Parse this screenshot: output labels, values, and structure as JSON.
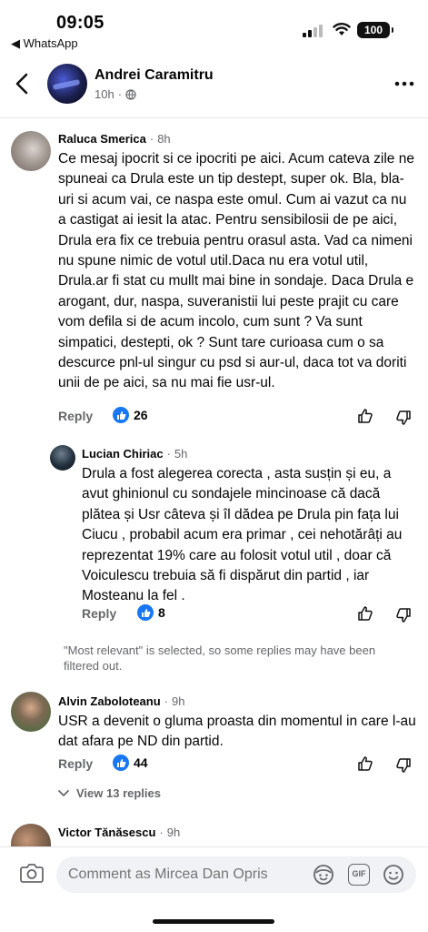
{
  "status_bar": {
    "time": "09:05",
    "back_app": "◀ WhatsApp",
    "battery": "100"
  },
  "header": {
    "name": "Andrei Caramitru",
    "time_ago": "10h"
  },
  "comments": [
    {
      "author": "Raluca Smerica",
      "time_ago": "8h",
      "text": "Ce mesaj ipocrit si ce ipocriti pe aici. Acum cateva zile ne spuneai ca Drula este un tip destept, super ok. Bla, bla-uri si acum vai, ce naspa este omul. Cum ai vazut ca nu a castigat ai iesit la atac. Pentru sensibilosii de pe aici, Drula era fix ce trebuia pentru orasul asta. Vad ca nimeni nu spune nimic de votul util.Daca nu era votul util, Drula.ar fi stat cu mullt mai bine in sondaje. Daca Drula e arogant, dur, naspa, suveranistii lui peste prajit cu care vom defila si de acum incolo, cum sunt ? Va sunt simpatici, destepti, ok ?  Sunt tare curioasa cum o sa descurce pnl-ul singur cu psd si aur-ul, daca tot va doriti unii de pe aici, sa nu mai fie usr-ul.",
      "reply_label": "Reply",
      "likes": "26"
    },
    {
      "author": "Lucian Chiriac",
      "time_ago": "5h",
      "text": "Drula a fost alegerea corecta , asta susțin și eu, a avut ghinionul cu sondajele mincinoase că dacă plătea și Usr câteva și îl dădea pe Drula pin fața lui Ciucu , probabil acum era primar , cei nehotărâți au reprezentat 19% care au folosit votul util , doar că Voiculescu trebuia să fi dispărut din partid , iar Mosteanu la fel .",
      "reply_label": "Reply",
      "likes": "8"
    },
    {
      "author": "Alvin Zaboloteanu",
      "time_ago": "9h",
      "text": "USR a devenit o gluma proasta din momentul in care l-au dat afara pe ND din partid.",
      "reply_label": "Reply",
      "likes": "44"
    },
    {
      "author": "Victor Tănăsescu",
      "time_ago": "9h"
    }
  ],
  "filter_notice": "\"Most relevant\" is selected, so some replies may have been filtered out.",
  "view_replies": "View 13 replies",
  "composer": {
    "placeholder": "Comment as Mircea Dan Opris",
    "gif_label": "GIF"
  },
  "colors": {
    "accent": "#1877f2",
    "secondary_text": "#65676b",
    "input_bg": "#f0f2f5"
  }
}
